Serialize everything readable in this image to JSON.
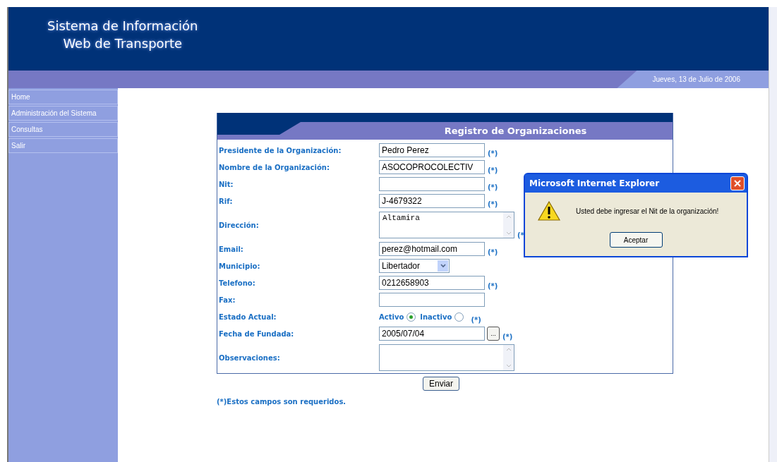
{
  "header": {
    "title_line_1": "Sistema de Información",
    "title_line_2": "Web de Transporte",
    "date": "Jueves, 13 de Julio de 2006"
  },
  "sidebar": {
    "items": [
      {
        "label": "Home"
      },
      {
        "label": "Administración del Sistema"
      },
      {
        "label": "Consultas"
      },
      {
        "label": "Salir"
      }
    ]
  },
  "form": {
    "title": "Registro de Organizaciones",
    "fields": [
      {
        "kind": "text",
        "label": "Presidente de la Organización:",
        "value": "Pedro Perez",
        "required": "(*)"
      },
      {
        "kind": "text",
        "label": "Nombre de la Organización:",
        "value": "ASOCOPROCOLECTIV",
        "required": "(*)"
      },
      {
        "kind": "text",
        "label": "Nit:",
        "required": "(*)"
      },
      {
        "kind": "text",
        "label": "Rif:",
        "value": "J-4679322",
        "required": "(*)"
      },
      {
        "kind": "textarea",
        "label": "Dirección:",
        "value": "Altamira",
        "required": "(*"
      },
      {
        "kind": "text",
        "label": "Email:",
        "value": "perez@hotmail.com",
        "required": "(*)"
      },
      {
        "kind": "select",
        "label": "Municipio:",
        "value": "Libertador"
      },
      {
        "kind": "text",
        "label": "Telefono:",
        "value": "0212658903",
        "required": "(*)"
      },
      {
        "kind": "text",
        "label": "Fax:"
      },
      {
        "kind": "radio",
        "label": "Estado Actual:",
        "options": [
          {
            "label": "Activo",
            "selected": true
          },
          {
            "label": "Inactivo",
            "selected": false
          }
        ],
        "required": "(*)"
      },
      {
        "kind": "date",
        "label": "Fecha de Fundada:",
        "value": "2005/07/04",
        "button": "...",
        "required": "(*)"
      },
      {
        "kind": "textarea",
        "label": "Observaciones:"
      }
    ],
    "submit": "Enviar",
    "note": "(*)Estos campos son requeridos."
  },
  "dialog": {
    "title": "Microsoft Internet Explorer",
    "message": "Usted debe ingresar el Nit de la organización!",
    "button": "Aceptar"
  }
}
